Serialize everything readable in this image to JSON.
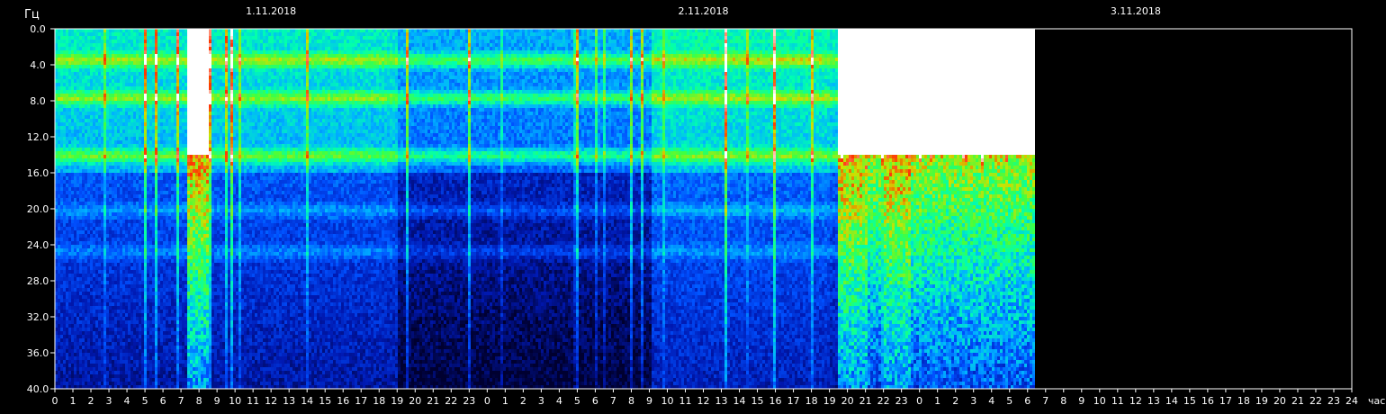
{
  "chart_data": {
    "type": "heatmap",
    "title": "",
    "ylabel": "Гц",
    "xlabel": "час",
    "ylim": [
      0,
      40
    ],
    "y_ticks": [
      "0.0",
      "4.0",
      "8.0",
      "12.0",
      "16.0",
      "20.0",
      "24.0",
      "28.0",
      "32.0",
      "36.0",
      "40.0"
    ],
    "x_tick_labels": [
      "0",
      "1",
      "2",
      "3",
      "4",
      "5",
      "6",
      "7",
      "8",
      "9",
      "10",
      "11",
      "12",
      "13",
      "14",
      "15",
      "16",
      "17",
      "18",
      "19",
      "20",
      "21",
      "22",
      "23",
      "0",
      "1",
      "2",
      "3",
      "4",
      "5",
      "6",
      "7",
      "8",
      "9",
      "10",
      "11",
      "12",
      "13",
      "14",
      "15",
      "16",
      "17",
      "18",
      "19",
      "20",
      "21",
      "22",
      "23",
      "0",
      "1",
      "2",
      "3",
      "4",
      "5",
      "6",
      "7",
      "8",
      "9",
      "10",
      "11",
      "12",
      "13",
      "14",
      "15",
      "16",
      "17",
      "18",
      "19",
      "20",
      "21",
      "22",
      "23",
      "24"
    ],
    "dates": [
      {
        "label": "1.11.2018",
        "hour_offset": 12
      },
      {
        "label": "2.11.2018",
        "hour_offset": 36
      },
      {
        "label": "3.11.2018",
        "hour_offset": 60
      }
    ],
    "x_range_hours": [
      0,
      72
    ],
    "data_end_hours": 54.4,
    "colormap": [
      "#000030",
      "#0018b0",
      "#0050ff",
      "#00b4ff",
      "#00ffb0",
      "#40ff40",
      "#d0e000",
      "#ff3000",
      "#ffffff"
    ],
    "background_color": "#000000",
    "axis_color": "#ffffff",
    "resonance_bands_hz": [
      3.5,
      7.7,
      14.1,
      20.2,
      24.8
    ],
    "high_intensity_periods_hours": [
      [
        7.2,
        8.4
      ],
      [
        43.4,
        54.4
      ]
    ]
  }
}
